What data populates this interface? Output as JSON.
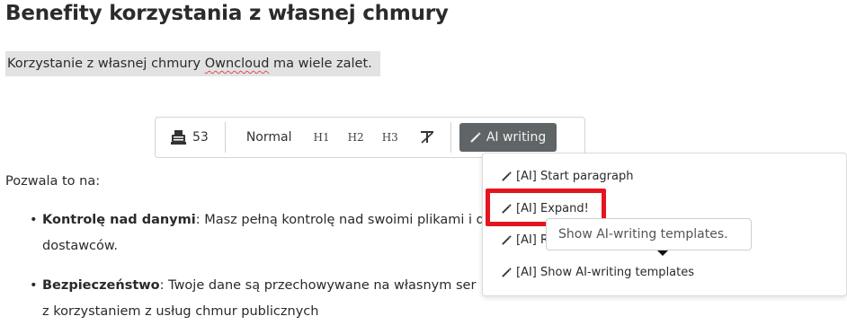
{
  "heading": "Benefity korzystania z własnej chmury",
  "intro": {
    "before": "Korzystanie z własnej chmury ",
    "link": "Owncloud",
    "after": " ma wiele zalet."
  },
  "toolbar": {
    "count": "53",
    "normal": "Normal",
    "h1": "H1",
    "h2": "H2",
    "h3": "H3",
    "ai_writing": "AI writing"
  },
  "body_text": "Pozwala to na:",
  "bullets": [
    {
      "bold": "Kontrolę nad danymi",
      "text": ": Masz pełną kontrolę nad swoimi plikami i d",
      "cont": "dostawców.",
      "right_tail": "i"
    },
    {
      "bold": "Bezpieczeństwo",
      "text": ": Twoje dane są przechowywane na własnym ser",
      "cont": "z korzystaniem z usług chmur publicznych",
      "right_tail": "w"
    }
  ],
  "dropdown": {
    "items": [
      "[AI] Start paragraph",
      "[AI] Expand!",
      "[AI] Rephr",
      "[AI] Show AI-writing templates"
    ]
  },
  "tooltip": "Show AI-writing templates."
}
